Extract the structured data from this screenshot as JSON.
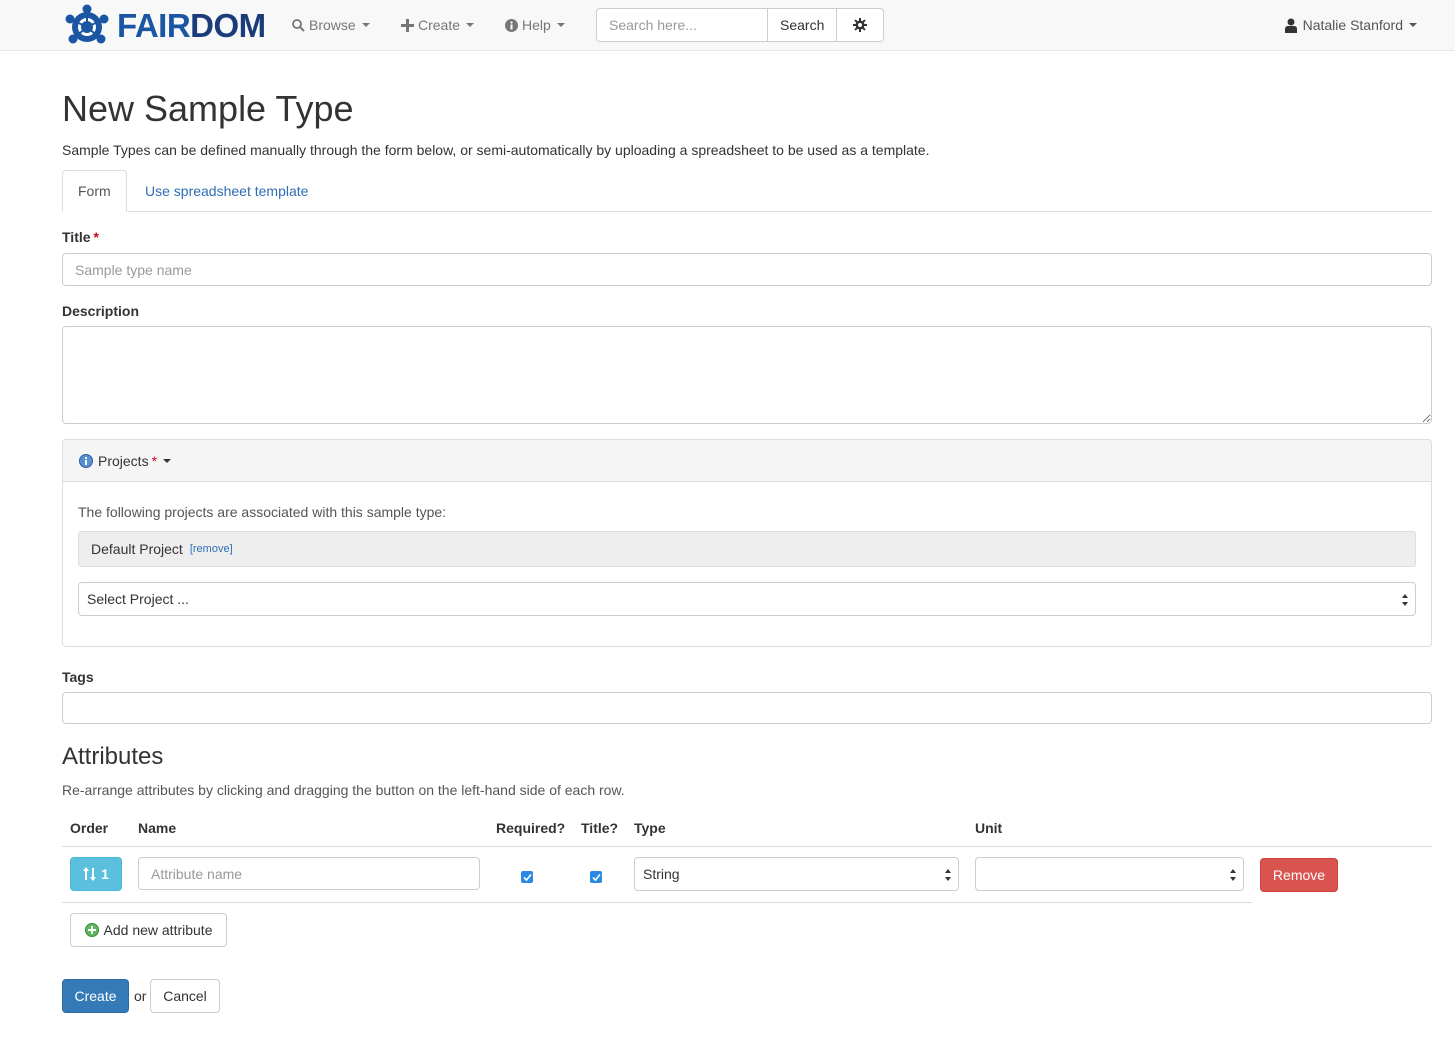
{
  "navbar": {
    "logo_fair": "FAIR",
    "logo_dom": "DOM",
    "browse": "Browse",
    "create": "Create",
    "help": "Help",
    "search_placeholder": "Search here...",
    "search_button": "Search",
    "user_name": "Natalie Stanford"
  },
  "page": {
    "title": "New Sample Type",
    "intro": "Sample Types can be defined manually through the form below, or semi-automatically by uploading a spreadsheet to be used as a template."
  },
  "tabs": [
    {
      "label": "Form",
      "active": true
    },
    {
      "label": "Use spreadsheet template",
      "active": false
    }
  ],
  "form": {
    "title_label": "Title",
    "title_placeholder": "Sample type name",
    "description_label": "Description",
    "required_mark": "*",
    "tags_label": "Tags"
  },
  "projects": {
    "heading": "Projects",
    "associated_text": "The following projects are associated with this sample type:",
    "selected": [
      {
        "name": "Default Project",
        "remove_label": "[remove]"
      }
    ],
    "select_value": "Select Project ..."
  },
  "attributes": {
    "heading": "Attributes",
    "subtitle": "Re-arrange attributes by clicking and dragging the button on the left-hand side of each row.",
    "columns": [
      "Order",
      "Name",
      "Required?",
      "Title?",
      "Type",
      "Unit"
    ],
    "rows": [
      {
        "order": "1",
        "name_placeholder": "Attribute name",
        "required": true,
        "is_title": true,
        "type": "String",
        "unit": "",
        "remove_label": "Remove"
      }
    ],
    "add_button": "Add new attribute"
  },
  "actions": {
    "create": "Create",
    "or": "or",
    "cancel": "Cancel"
  },
  "colors": {
    "brand_blue": "#1b56a4",
    "link": "#2f6eb5",
    "primary": "#337ab7",
    "info": "#5bc0de",
    "danger": "#d9534f",
    "required": "#d0021b"
  }
}
